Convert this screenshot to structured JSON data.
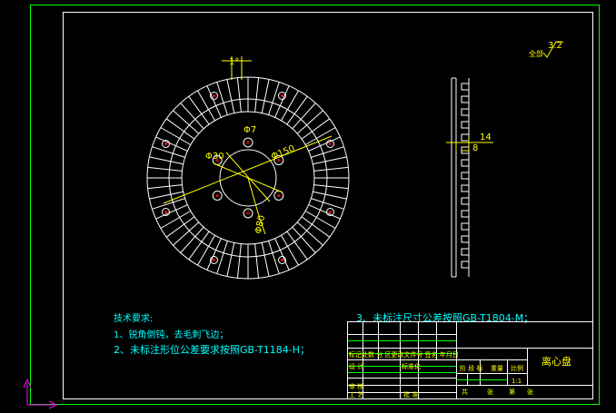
{
  "drawing": {
    "front_view": {
      "angle_label": "1°",
      "dim_d7": "Φ7",
      "dim_d150": "Φ150",
      "dim_d30": "Φ30",
      "dim_d80": "Φ80"
    },
    "side_view": {
      "dim_14": "14",
      "dim_8": "8"
    },
    "roughness": {
      "value": "3.2",
      "label": "全部"
    },
    "notes": {
      "title": "技术要求:",
      "line1": "1、锐角倒钝，去毛刺飞边；",
      "line2": "2、未标注形位公差要求按照GB-T1184-H；",
      "line3": "3、未标注尺寸公差按照GB-T1804-M；"
    },
    "title_block": {
      "part_name": "离心盘",
      "row_change": "标记处数 分  区更改文件号 签名 年月日",
      "design": "设 计",
      "standardize": "标准化",
      "stage_mark": "阶 段 标",
      "weight": "重量",
      "scale_label": "比例",
      "scale_value": "1:1",
      "review": "审 核",
      "process": "工 艺",
      "approve": "批 准",
      "sheets_total": "共",
      "sheets_mid": "张",
      "sheet_no": "第",
      "sheet_end": "张"
    }
  },
  "colors": {
    "background": "#000000",
    "border": "#00ff00",
    "geometry": "#ffffff",
    "annotation": "#ffff00",
    "note_text": "#00ffff",
    "hole": "#ff0000",
    "ucs": "#ff00ff"
  }
}
